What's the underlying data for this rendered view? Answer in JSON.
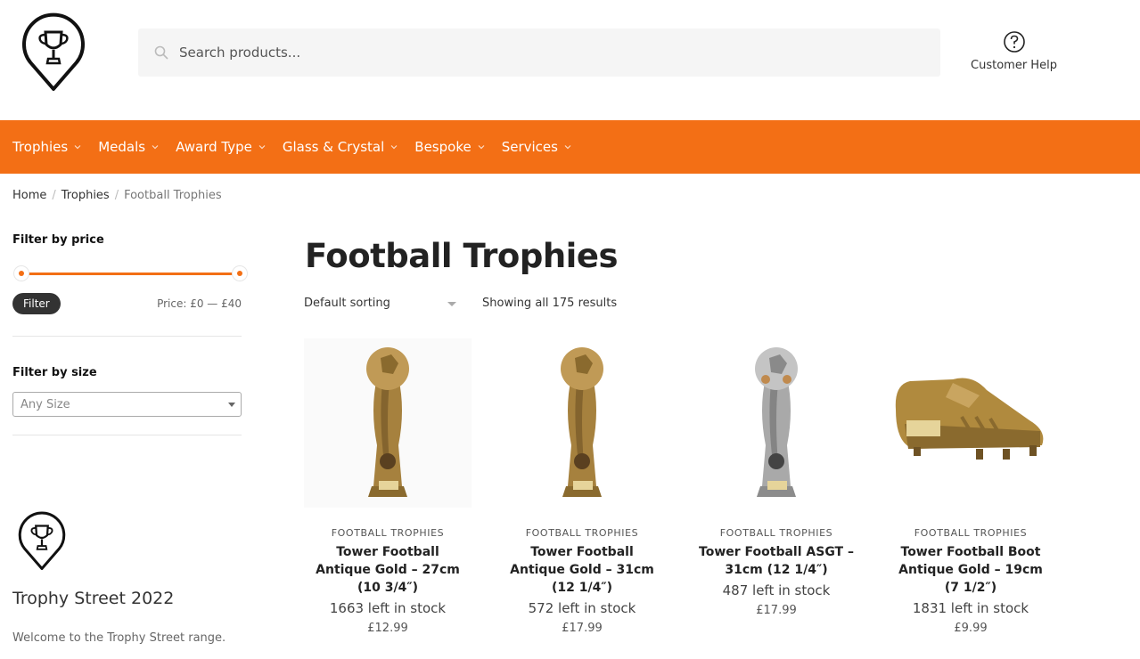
{
  "header": {
    "search_placeholder": "Search products...",
    "help_label": "Customer Help"
  },
  "nav": {
    "items": [
      {
        "label": "Trophies"
      },
      {
        "label": "Medals"
      },
      {
        "label": "Award Type"
      },
      {
        "label": "Glass & Crystal"
      },
      {
        "label": "Bespoke"
      },
      {
        "label": "Services"
      }
    ]
  },
  "breadcrumb": {
    "home": "Home",
    "parent": "Trophies",
    "current": "Football Trophies",
    "separator": "/"
  },
  "sidebar": {
    "price_title": "Filter by price",
    "filter_button": "Filter",
    "price_range": "Price: £0 — £40",
    "size_title": "Filter by size",
    "size_selected": "Any Size",
    "brand_title": "Trophy Street 2022",
    "brand_text": "Welcome to the Trophy Street range."
  },
  "main": {
    "title": "Football Trophies",
    "sorting": "Default sorting",
    "results": "Showing all 175 results"
  },
  "products": [
    {
      "category": "FOOTBALL TROPHIES",
      "name": "Tower Football Antique Gold – 27cm (10 3/4″)",
      "stock": "1663 left in stock",
      "price": "£12.99",
      "image": "gold-football-tower-trophy"
    },
    {
      "category": "FOOTBALL TROPHIES",
      "name": "Tower Football Antique Gold – 31cm (12 1/4″)",
      "stock": "572 left in stock",
      "price": "£17.99",
      "image": "gold-football-tower-trophy"
    },
    {
      "category": "FOOTBALL TROPHIES",
      "name": "Tower Football ASGT – 31cm (12 1/4″)",
      "stock": "487 left in stock",
      "price": "£17.99",
      "image": "silver-gold-football-tower-trophy"
    },
    {
      "category": "FOOTBALL TROPHIES",
      "name": "Tower Football Boot Antique Gold – 19cm (7 1/2″)",
      "stock": "1831 left in stock",
      "price": "£9.99",
      "image": "gold-football-boot-trophy"
    }
  ],
  "colors": {
    "accent": "#f36f15",
    "dark": "#333333"
  }
}
